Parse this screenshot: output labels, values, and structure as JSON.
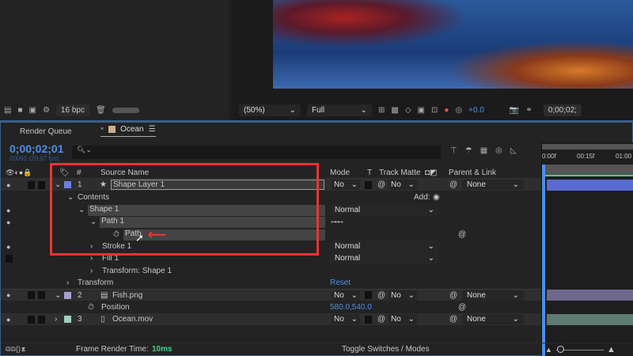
{
  "project_toolbar": {
    "bpc": "16 bpc",
    "icons": [
      "render-queue-icon",
      "folder-icon",
      "composition-icon",
      "flow-icon",
      "trash-icon"
    ]
  },
  "viewer_toolbar": {
    "zoom": "(50%)",
    "resolution": "Full",
    "exposure": "+0.0",
    "timecode": "0;00;02;"
  },
  "tabs": [
    {
      "label": "Render Queue"
    },
    {
      "label": "Ocean"
    }
  ],
  "timeline": {
    "timecode": "0;00;02;01",
    "frames": "00061 (29.97 fps)",
    "search_placeholder": "",
    "ruler": [
      "0:00f",
      "00:15f",
      "01:00"
    ]
  },
  "columns": {
    "num": "#",
    "source": "Source Name",
    "mode": "Mode",
    "t": "T",
    "track_matte": "Track Matte",
    "parent": "Parent & Link"
  },
  "layers": [
    {
      "num": "1",
      "name": "Shape Layer 1",
      "color": "#6b7fe0",
      "mode": "No",
      "matte": "No",
      "parent": "None"
    },
    {
      "num": "2",
      "name": "Fish.png",
      "color": "#a79fd0",
      "mode": "No",
      "matte": "No",
      "parent": "None"
    },
    {
      "num": "3",
      "name": "Ocean.mov",
      "color": "#9fd0c0",
      "mode": "No",
      "matte": "No",
      "parent": "None"
    }
  ],
  "props": {
    "contents": "Contents",
    "add": "Add:",
    "shape1": "Shape 1",
    "path1": "Path 1",
    "path": "Path",
    "stroke1": "Stroke 1",
    "fill1": "Fill 1",
    "transform_shape": "Transform: Shape 1",
    "transform": "Transform",
    "reset": "Reset",
    "position": "Position",
    "position_value": "580.0,540.0",
    "normal": "Normal"
  },
  "footer": {
    "frame_render_label": "Frame Render Time:",
    "frame_render_value": "10ms",
    "toggle": "Toggle Switches / Modes"
  },
  "colors": {
    "accent": "#4d8fe6",
    "highlight": "#e33333",
    "green": "#3fcf8e"
  }
}
